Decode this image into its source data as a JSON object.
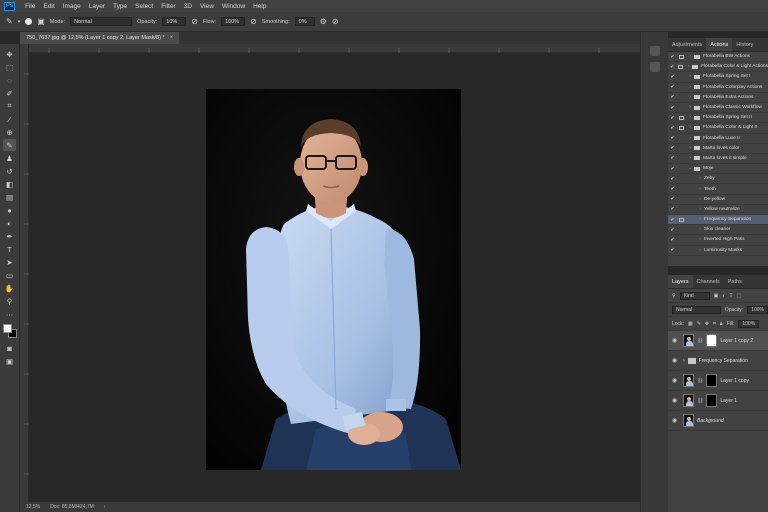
{
  "app": {
    "logo": "Ps"
  },
  "menubar": [
    "File",
    "Edit",
    "Image",
    "Layer",
    "Type",
    "Select",
    "Filter",
    "3D",
    "View",
    "Window",
    "Help"
  ],
  "options": {
    "mode_label": "Mode:",
    "mode_value": "Normal",
    "opacity_label": "Opacity:",
    "opacity_value": "10%",
    "flow_label": "Flow:",
    "flow_value": "100%",
    "smoothing_label": "Smoothing:",
    "smoothing_value": "0%"
  },
  "document": {
    "tab_title": "750_7637.jpg @ 12,5% (Layer 1 copy 2, Layer Mask/8) *",
    "close": "×"
  },
  "status": {
    "zoom": "12,5%",
    "doc_info": "Doc: 85,8M/424,7M"
  },
  "actions_panel": {
    "tabs": [
      "Adjustments",
      "Actions",
      "History"
    ],
    "active_tab": "Actions",
    "rows": [
      {
        "check": "✔",
        "dialog": true,
        "arrow": "›",
        "type": "folder",
        "label": "Florabella BW Actions"
      },
      {
        "check": "✔",
        "dialog": true,
        "arrow": "›",
        "type": "folder",
        "label": "Florabella Color & Light Actions"
      },
      {
        "check": "✔",
        "dialog": false,
        "arrow": "›",
        "type": "folder",
        "label": "Florabella Spring Set I"
      },
      {
        "check": "✔",
        "dialog": false,
        "arrow": "›",
        "type": "folder",
        "label": "Florabella Colorplay Actions"
      },
      {
        "check": "✔",
        "dialog": false,
        "arrow": "›",
        "type": "folder",
        "label": "Florabella Extra Actions"
      },
      {
        "check": "✔",
        "dialog": false,
        "arrow": "›",
        "type": "folder",
        "label": "Florabella Classic Workflow"
      },
      {
        "check": "✔",
        "dialog": true,
        "arrow": "›",
        "type": "folder",
        "label": "Florabella Spring Set II"
      },
      {
        "check": "✔",
        "dialog": true,
        "arrow": "›",
        "type": "folder",
        "label": "Florabella Color & Light II"
      },
      {
        "check": "✔",
        "dialog": false,
        "arrow": "›",
        "type": "folder",
        "label": "Florabella Luxe II"
      },
      {
        "check": "✔",
        "dialog": false,
        "arrow": "›",
        "type": "folder",
        "label": "Marta loves color"
      },
      {
        "check": "✔",
        "dialog": false,
        "arrow": "›",
        "type": "folder",
        "label": "Marta loves it simple"
      },
      {
        "check": "✔",
        "dialog": false,
        "arrow": "⌄",
        "type": "folder",
        "label": "Moje"
      },
      {
        "check": "✔",
        "dialog": false,
        "arrow": "›",
        "type": "action",
        "label": "Zeby"
      },
      {
        "check": "✔",
        "dialog": false,
        "arrow": "›",
        "type": "action",
        "label": "Teeth"
      },
      {
        "check": "✔",
        "dialog": false,
        "arrow": "›",
        "type": "action",
        "label": "De-yellow"
      },
      {
        "check": "✔",
        "dialog": false,
        "arrow": "›",
        "type": "action",
        "label": "Yellow neutralize"
      },
      {
        "check": "✔",
        "dialog": true,
        "arrow": "›",
        "type": "action",
        "label": "Frequency Separation",
        "selected": true
      },
      {
        "check": "✔",
        "dialog": false,
        "arrow": "›",
        "type": "action",
        "label": "Skin cleaner"
      },
      {
        "check": "✔",
        "dialog": false,
        "arrow": "›",
        "type": "action",
        "label": "Inverted High Pass"
      },
      {
        "check": "✔",
        "dialog": false,
        "arrow": "›",
        "type": "action",
        "label": "Luminosity Masks"
      }
    ]
  },
  "layers_panel": {
    "tabs": [
      "Layers",
      "Channels",
      "Paths"
    ],
    "active_tab": "Layers",
    "filter_value": "Kind",
    "blend_value": "Normal",
    "opacity_label": "Opacity:",
    "opacity_value": "100%",
    "lock_label": "Lock:",
    "fill_label": "Fill:",
    "fill_value": "100%",
    "layers": [
      {
        "name": "Layer 1 copy 2",
        "mask": "white",
        "selected": true
      },
      {
        "name": "Frequency Separation",
        "group": true
      },
      {
        "name": "Layer 1 copy",
        "mask": "black"
      },
      {
        "name": "Layer 1",
        "mask": "black"
      },
      {
        "name": "Background",
        "italic": true
      }
    ]
  }
}
